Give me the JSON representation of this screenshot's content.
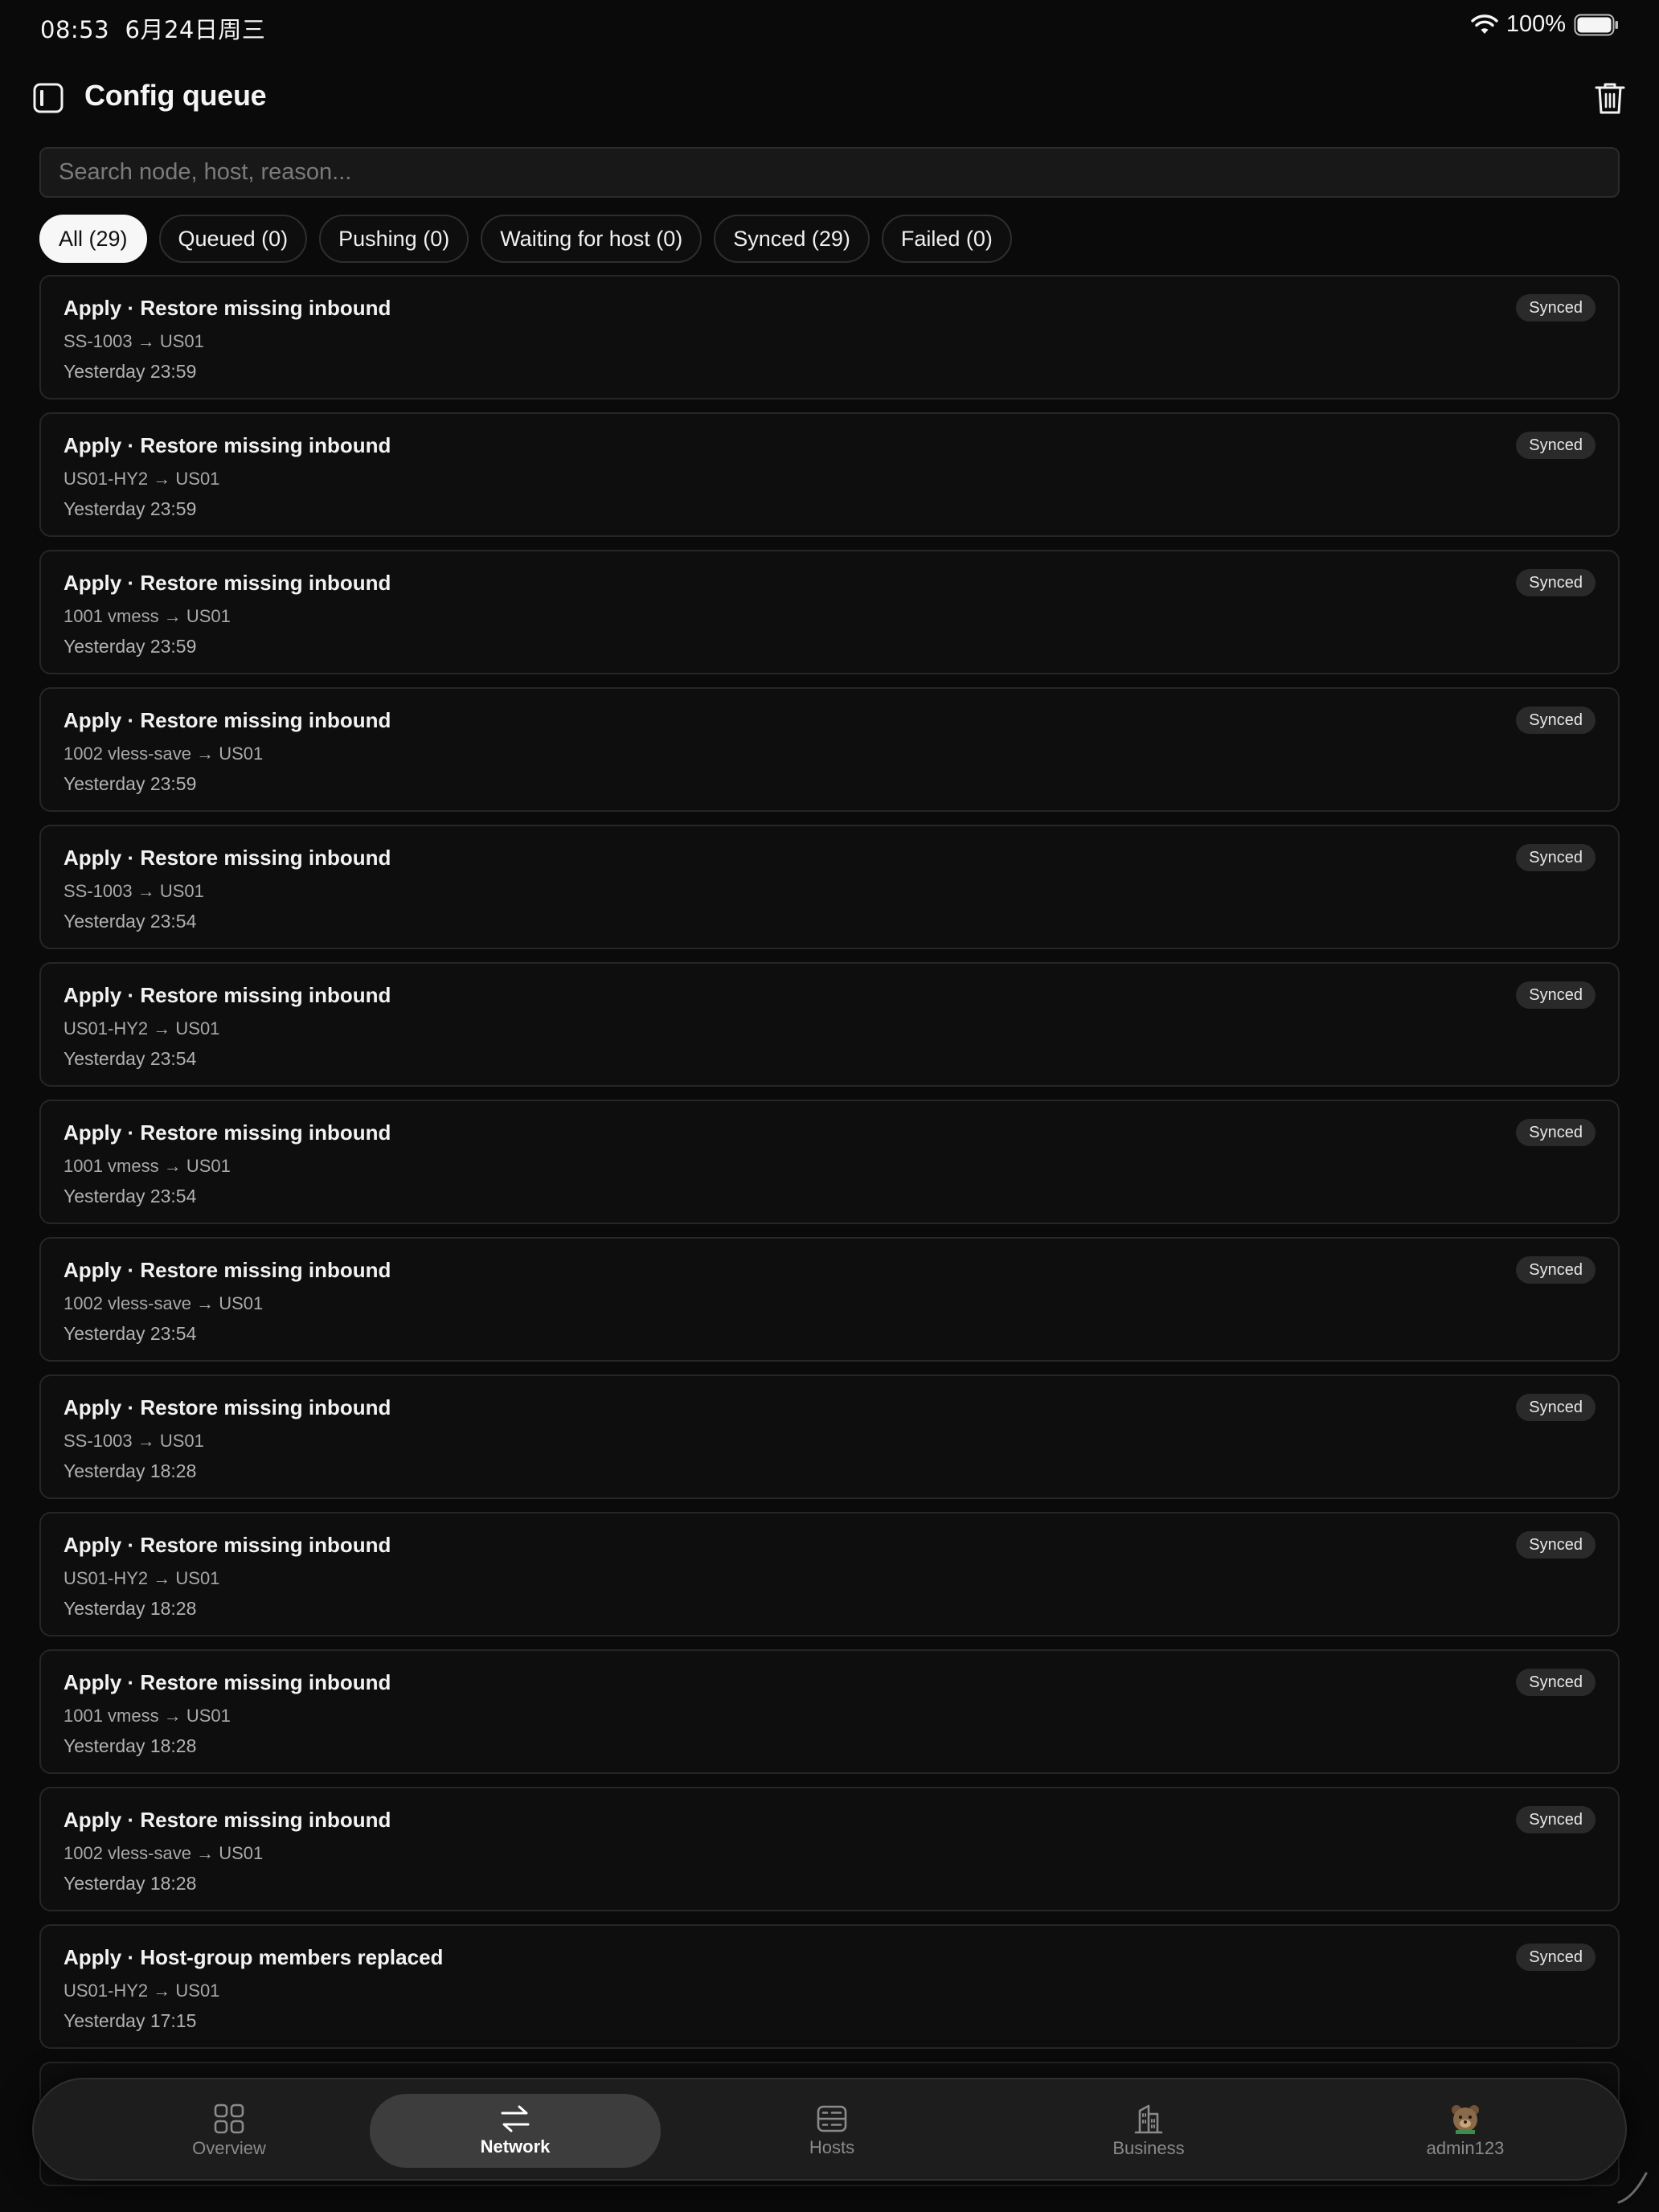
{
  "status_bar": {
    "time": "08:53",
    "date": "6月24日周三",
    "battery": "100%"
  },
  "header": {
    "title": "Config queue",
    "toggle_icon": "sidebar-toggle-icon",
    "trash_icon": "trash-icon"
  },
  "search": {
    "placeholder": "Search node, host, reason...",
    "value": ""
  },
  "filters": [
    {
      "label": "All (29)",
      "active": true
    },
    {
      "label": "Queued (0)"
    },
    {
      "label": "Pushing (0)"
    },
    {
      "label": "Waiting for host (0)"
    },
    {
      "label": "Synced (29)"
    },
    {
      "label": "Failed (0)"
    }
  ],
  "items": [
    {
      "title": "Apply · Restore missing inbound",
      "route": "SS-1003 → US01",
      "time": "Yesterday 23:59",
      "status": "Synced"
    },
    {
      "title": "Apply · Restore missing inbound",
      "route": "US01-HY2 → US01",
      "time": "Yesterday 23:59",
      "status": "Synced"
    },
    {
      "title": "Apply · Restore missing inbound",
      "route": "1001 vmess → US01",
      "time": "Yesterday 23:59",
      "status": "Synced"
    },
    {
      "title": "Apply · Restore missing inbound",
      "route": "1002 vless-save → US01",
      "time": "Yesterday 23:59",
      "status": "Synced"
    },
    {
      "title": "Apply · Restore missing inbound",
      "route": "SS-1003 → US01",
      "time": "Yesterday 23:54",
      "status": "Synced"
    },
    {
      "title": "Apply · Restore missing inbound",
      "route": "US01-HY2 → US01",
      "time": "Yesterday 23:54",
      "status": "Synced"
    },
    {
      "title": "Apply · Restore missing inbound",
      "route": "1001 vmess → US01",
      "time": "Yesterday 23:54",
      "status": "Synced"
    },
    {
      "title": "Apply · Restore missing inbound",
      "route": "1002 vless-save → US01",
      "time": "Yesterday 23:54",
      "status": "Synced"
    },
    {
      "title": "Apply · Restore missing inbound",
      "route": "SS-1003 → US01",
      "time": "Yesterday 18:28",
      "status": "Synced"
    },
    {
      "title": "Apply · Restore missing inbound",
      "route": "US01-HY2 → US01",
      "time": "Yesterday 18:28",
      "status": "Synced"
    },
    {
      "title": "Apply · Restore missing inbound",
      "route": "1001 vmess → US01",
      "time": "Yesterday 18:28",
      "status": "Synced"
    },
    {
      "title": "Apply · Restore missing inbound",
      "route": "1002 vless-save → US01",
      "time": "Yesterday 18:28",
      "status": "Synced"
    },
    {
      "title": "Apply · Host-group members replaced",
      "route": "US01-HY2 → US01",
      "time": "Yesterday 17:15",
      "status": "Synced"
    }
  ],
  "tabs": [
    {
      "label": "Overview",
      "icon": "grid-icon"
    },
    {
      "label": "Network",
      "icon": "swap-arrows-icon",
      "active": true
    },
    {
      "label": "Hosts",
      "icon": "server-icon"
    },
    {
      "label": "Business",
      "icon": "building-icon"
    },
    {
      "label": "admin123",
      "icon": "avatar"
    }
  ],
  "colors": {
    "background": "#0a0a0a",
    "card": "#0e0e0e",
    "badge": "#2a2a2a",
    "active_chip": "#f7f7f7"
  }
}
